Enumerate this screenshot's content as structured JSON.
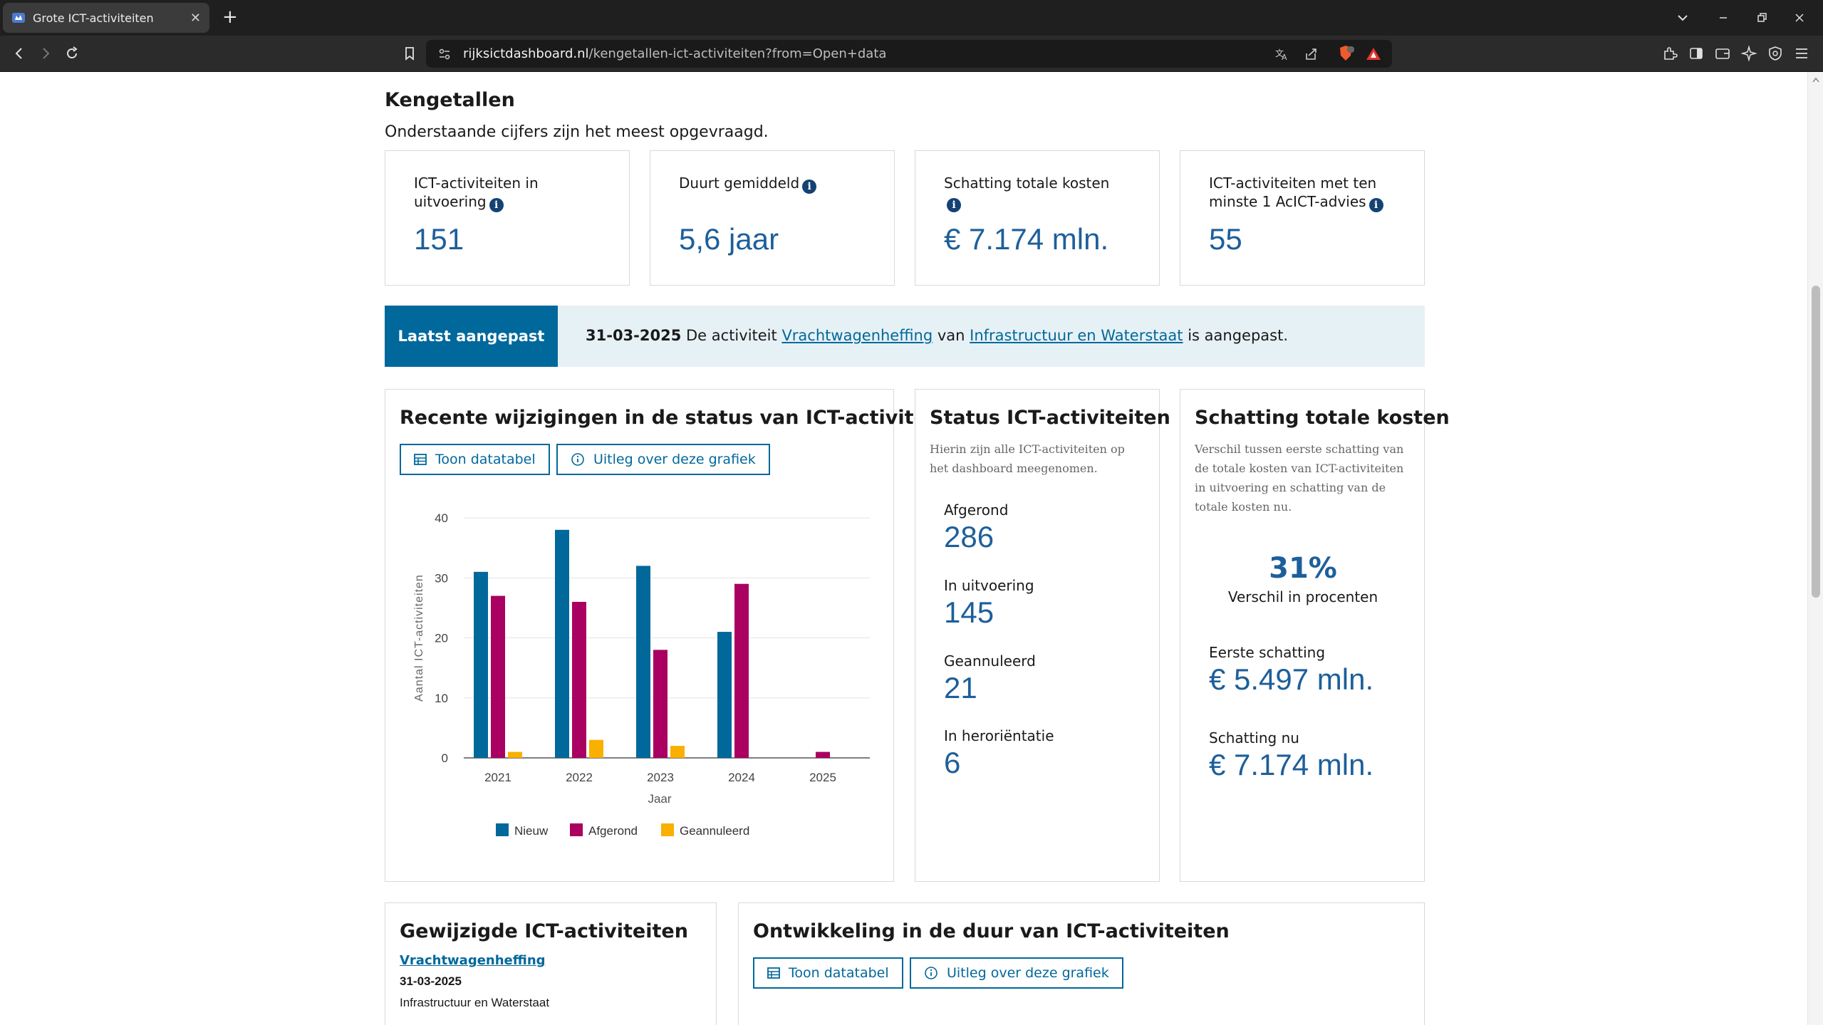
{
  "browser": {
    "tab_title": "Grote ICT-activiteiten",
    "url_domain": "rijksictdashboard.nl",
    "url_path": "/kengetallen-ict-activiteiten?from=Open+data"
  },
  "kengetallen": {
    "title": "Kengetallen",
    "subtitle": "Onderstaande cijfers zijn het meest opgevraagd.",
    "cards": [
      {
        "label": "ICT-activiteiten in uitvoering",
        "value": "151"
      },
      {
        "label": "Duurt gemiddeld",
        "value": "5,6 jaar"
      },
      {
        "label": "Schatting totale kosten",
        "value": "€ 7.174 mln."
      },
      {
        "label": "ICT-activiteiten met ten minste 1 AcICT-advies",
        "value": "55"
      }
    ]
  },
  "banner": {
    "label": "Laatst aangepast",
    "date": "31-03-2025",
    "text1": "De activiteit",
    "link1": "Vrachtwagenheffing",
    "text2": "van",
    "link2": "Infrastructuur en Waterstaat",
    "text3": "is aangepast."
  },
  "recent_card": {
    "title": "Recente wijzigingen in de status van ICT-activiteiten",
    "btn_table": "Toon datatabel",
    "btn_explain": "Uitleg over deze grafiek"
  },
  "chart_data": {
    "type": "bar",
    "categories": [
      "2021",
      "2022",
      "2023",
      "2024",
      "2025"
    ],
    "series": [
      {
        "name": "Nieuw",
        "color": "#01689b",
        "values": [
          31,
          38,
          32,
          21,
          0
        ]
      },
      {
        "name": "Afgerond",
        "color": "#a90061",
        "values": [
          27,
          26,
          18,
          29,
          1
        ]
      },
      {
        "name": "Geannuleerd",
        "color": "#f9b000",
        "values": [
          1,
          3,
          2,
          0,
          0
        ]
      }
    ],
    "xlabel": "Jaar",
    "ylabel": "Aantal ICT-activiteiten",
    "ylim": [
      0,
      40
    ],
    "yticks": [
      "0",
      "10",
      "20",
      "30",
      "40"
    ],
    "grid": true,
    "legend": "bottom"
  },
  "status_card": {
    "title": "Status ICT-activiteiten",
    "description": "Hierin zijn alle ICT-activiteiten op het dashboard meegenomen.",
    "items": [
      {
        "label": "Afgerond",
        "value": "286"
      },
      {
        "label": "In uitvoering",
        "value": "145"
      },
      {
        "label": "Geannuleerd",
        "value": "21"
      },
      {
        "label": "In heroriëntatie",
        "value": "6"
      }
    ]
  },
  "kosten_card": {
    "title": "Schatting totale kosten",
    "description": "Verschil tussen eerste schatting van de totale kosten van ICT-activiteiten in uitvoering en schatting van de totale kosten nu.",
    "percentage": "31%",
    "percentage_label": "Verschil in procenten",
    "first_label": "Eerste schatting",
    "first_value": "€ 5.497 mln.",
    "now_label": "Schatting nu",
    "now_value": "€ 7.174 mln."
  },
  "gewijzigd_card": {
    "title": "Gewijzigde ICT-activiteiten",
    "item_link": "Vrachtwagenheffing",
    "item_date": "31-03-2025",
    "item_org": "Infrastructuur en Waterstaat"
  },
  "duur_card": {
    "title": "Ontwikkeling in de duur van ICT-activiteiten",
    "btn_table": "Toon datatabel",
    "btn_explain": "Uitleg over deze grafiek"
  }
}
